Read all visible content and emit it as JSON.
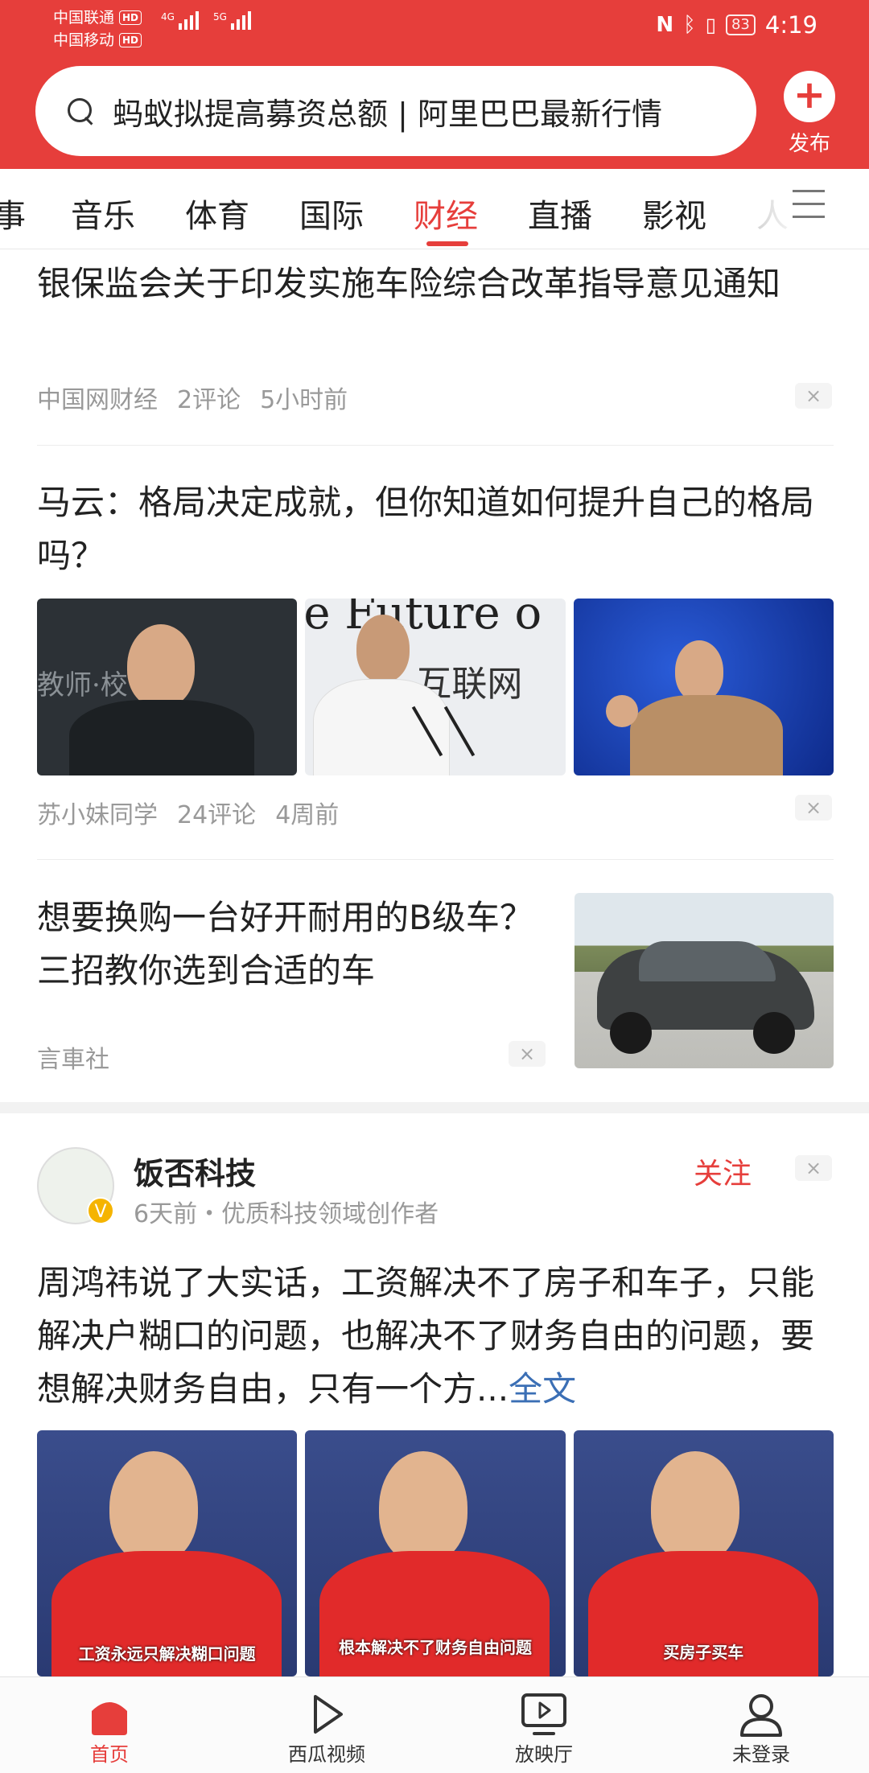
{
  "status_bar": {
    "carrier1": "中国联通",
    "carrier2": "中国移动",
    "hd": "HD",
    "net1": "4G",
    "net2": "5G",
    "battery": "83",
    "time": "4:19"
  },
  "search": {
    "text": "蚂蚁拟提高募资总额 | 阿里巴巴最新行情"
  },
  "publish": {
    "label": "发布"
  },
  "tabs": [
    {
      "label": "事"
    },
    {
      "label": "音乐"
    },
    {
      "label": "体育"
    },
    {
      "label": "国际"
    },
    {
      "label": "财经",
      "active": true
    },
    {
      "label": "直播"
    },
    {
      "label": "影视"
    },
    {
      "label": "人"
    }
  ],
  "feed": [
    {
      "title": "银保监会关于印发实施车险综合改革指导意见通知",
      "source": "中国网财经",
      "comments": "2评论",
      "time": "5小时前"
    },
    {
      "title": "马云：格局决定成就，但你知道如何提升自己的格局吗？",
      "source": "苏小妹同学",
      "comments": "24评论",
      "time": "4周前",
      "image_texts": [
        "教师·校",
        "e Future o",
        "互联网"
      ]
    },
    {
      "title": "想要换购一台好开耐用的B级车？三招教你选到合适的车",
      "source": "言車社"
    }
  ],
  "post": {
    "author": "饭否科技",
    "subtitle": "6天前・优质科技领域创作者",
    "follow": "关注",
    "text": "周鸿祎说了大实话，工资解决不了房子和车子，只能解决户糊口的问题，也解决不了财务自由的问题，要想解决财务自由，只有一个方...",
    "fulltext": "全文",
    "captions": [
      "工资永远只解决糊口问题",
      "根本解决不了财务自由问题",
      "买房子买车"
    ]
  },
  "close_glyph": "×",
  "bottom_nav": [
    {
      "label": "首页",
      "icon": "home-icon",
      "active": true
    },
    {
      "label": "西瓜视频",
      "icon": "play-icon"
    },
    {
      "label": "放映厅",
      "icon": "theater-icon"
    },
    {
      "label": "未登录",
      "icon": "user-icon"
    }
  ],
  "colors": {
    "accent": "#e63e3b",
    "link": "#3b6fb5",
    "meta": "#999999"
  }
}
